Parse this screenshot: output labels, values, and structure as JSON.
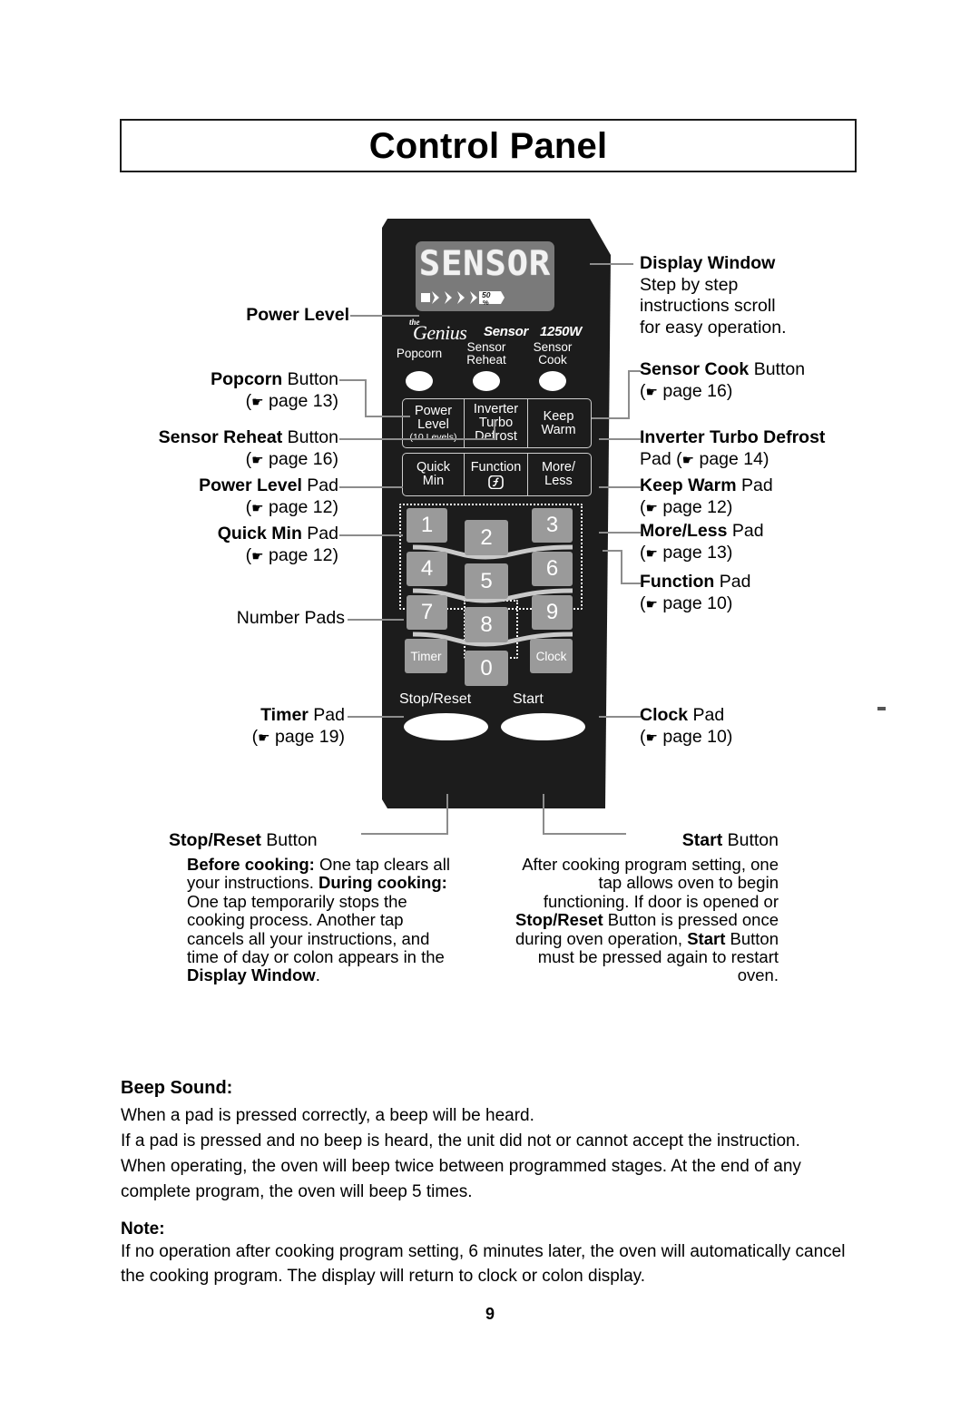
{
  "title": "Control Panel",
  "panel": {
    "display": {
      "text": "SENSOR",
      "power_value": "50",
      "power_unit": "%"
    },
    "brand": {
      "the": "the",
      "genius": "Genius",
      "sensor": "Sensor",
      "watts": "1250W"
    },
    "round_buttons": [
      {
        "label": "Popcorn"
      },
      {
        "label": "Sensor\nReheat"
      },
      {
        "label": "Sensor\nCook"
      }
    ],
    "pads_row1": [
      {
        "label": "Power\nLevel",
        "sub": "(10 Levels)"
      },
      {
        "label": "Inverter\nTurbo\nDefrost",
        "sub": ""
      },
      {
        "label": "Keep\nWarm",
        "sub": ""
      }
    ],
    "pads_row2": [
      {
        "label": "Quick\nMin",
        "sub": ""
      },
      {
        "label": "Function",
        "sub": ""
      },
      {
        "label": "More/\nLess",
        "sub": ""
      }
    ],
    "number_keys": [
      "1",
      "2",
      "3",
      "4",
      "5",
      "6",
      "7",
      "8",
      "9",
      "0"
    ],
    "timer_key": "Timer",
    "clock_key": "Clock",
    "stop_reset_label": "Stop/Reset",
    "start_label": "Start"
  },
  "callouts_left": [
    {
      "name": "power-level",
      "bold": "Power Level",
      "plain": "",
      "page": ""
    },
    {
      "name": "popcorn",
      "bold": "Popcorn",
      "plain": " Button",
      "page": "( page 13)"
    },
    {
      "name": "sensor-reheat",
      "bold": "Sensor Reheat",
      "plain": " Button",
      "page": "( page 16)"
    },
    {
      "name": "power-level-pad",
      "bold": "Power Level",
      "plain": " Pad",
      "page": "( page 12)"
    },
    {
      "name": "quick-min",
      "bold": "Quick Min",
      "plain": " Pad",
      "page": "( page 12)"
    },
    {
      "name": "number-pads",
      "bold": "",
      "plain": "Number Pads",
      "page": ""
    },
    {
      "name": "timer",
      "bold": "Timer",
      "plain": " Pad",
      "page": "( page 19)"
    }
  ],
  "callouts_right": {
    "display_window": {
      "bold": "Display Window",
      "lines": [
        "Step by step",
        "instructions scroll",
        "for easy operation."
      ]
    },
    "sensor_cook": {
      "bold": "Sensor Cook",
      "plain": " Button",
      "page": "( page 16)"
    },
    "inverter": {
      "bold": "Inverter Turbo Defrost",
      "plain": "",
      "page": "Pad ( page 14)"
    },
    "keep_warm": {
      "bold": "Keep Warm",
      "plain": " Pad",
      "page": "( page 12)"
    },
    "more_less": {
      "bold": "More/Less",
      "plain": " Pad",
      "page": "( page 13)"
    },
    "function": {
      "bold": "Function",
      "plain": " Pad",
      "page": "( page 10)"
    },
    "clock": {
      "bold": "Clock",
      "plain": " Pad",
      "page": "( page 10)"
    }
  },
  "stop_reset": {
    "heading_bold": "Stop/Reset",
    "heading_plain": " Button",
    "body_html": "<b>Before cooking:</b> One tap clears all your instructions. <b>During cooking:</b> One tap temporarily stops the cooking process. Another tap cancels all your instructions, and time of day or colon appears in the <b>Display Window</b>."
  },
  "start": {
    "heading_bold": "Start",
    "heading_plain": " Button",
    "body_html": "After cooking program setting, one tap allows oven to begin functioning. If door is opened or <b>Stop/Reset</b> Button is pressed once during oven operation, <b>Start</b> Button must be pressed again to restart oven."
  },
  "beep": {
    "heading": "Beep Sound:",
    "body_html": "When a pad is pressed correctly, a beep will be heard.<br>If a pad is pressed and no beep is heard, the unit did not or cannot accept the instruction.<br>When operating, the oven will beep twice between programmed stages. At the end of any complete program, the oven will beep 5 times."
  },
  "note": {
    "heading": "Note:",
    "body": "If no operation after cooking program setting, 6 minutes later, the oven will automatically cancel the cooking program. The display will return to clock or colon display."
  },
  "page_number": "9"
}
